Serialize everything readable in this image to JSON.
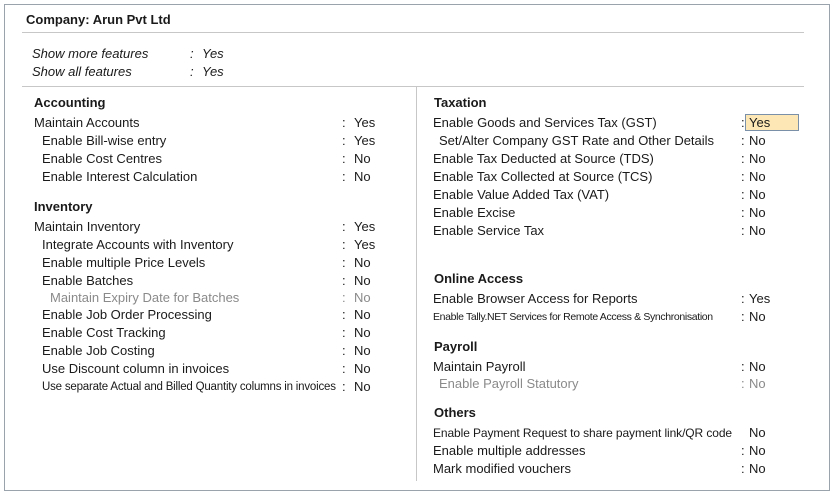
{
  "company": "Company: Arun Pvt Ltd",
  "features": [
    {
      "label": "Show more features",
      "value": "Yes"
    },
    {
      "label": "Show all features",
      "value": "Yes"
    }
  ],
  "accounting": {
    "title": "Accounting",
    "items": [
      {
        "label": "Maintain Accounts",
        "value": "Yes"
      },
      {
        "label": "Enable Bill-wise entry",
        "value": "Yes"
      },
      {
        "label": "Enable Cost Centres",
        "value": "No"
      },
      {
        "label": "Enable Interest Calculation",
        "value": "No"
      }
    ]
  },
  "inventory": {
    "title": "Inventory",
    "items": [
      {
        "label": "Maintain Inventory",
        "value": "Yes"
      },
      {
        "label": "Integrate Accounts with Inventory",
        "value": "Yes"
      },
      {
        "label": "Enable multiple Price Levels",
        "value": "No"
      },
      {
        "label": "Enable Batches",
        "value": "No"
      },
      {
        "label": "Maintain Expiry Date for Batches",
        "value": "No"
      },
      {
        "label": "Enable Job Order Processing",
        "value": "No"
      },
      {
        "label": "Enable Cost Tracking",
        "value": "No"
      },
      {
        "label": "Enable Job Costing",
        "value": "No"
      },
      {
        "label": "Use Discount column in invoices",
        "value": "No"
      },
      {
        "label": "Use separate Actual and Billed Quantity columns in invoices",
        "value": "No"
      }
    ]
  },
  "taxation": {
    "title": "Taxation",
    "items": [
      {
        "label": "Enable Goods and Services Tax (GST)",
        "value": "Yes"
      },
      {
        "label": "Set/Alter Company GST Rate and Other Details",
        "value": "No"
      },
      {
        "label": "Enable Tax Deducted at Source (TDS)",
        "value": "No"
      },
      {
        "label": "Enable Tax Collected at Source (TCS)",
        "value": "No"
      },
      {
        "label": "Enable Value Added Tax (VAT)",
        "value": "No"
      },
      {
        "label": "Enable Excise",
        "value": "No"
      },
      {
        "label": "Enable Service Tax",
        "value": "No"
      }
    ]
  },
  "online": {
    "title": "Online Access",
    "items": [
      {
        "label": "Enable Browser Access for Reports",
        "value": "Yes"
      },
      {
        "label": "Enable Tally.NET Services for Remote Access & Synchronisation",
        "value": "No"
      }
    ]
  },
  "payroll": {
    "title": "Payroll",
    "items": [
      {
        "label": "Maintain Payroll",
        "value": "No"
      },
      {
        "label": "Enable Payroll Statutory",
        "value": "No"
      }
    ]
  },
  "others": {
    "title": "Others",
    "items": [
      {
        "label": "Enable Payment Request to share payment link/QR code",
        "value": "No"
      },
      {
        "label": "Enable multiple addresses",
        "value": "No"
      },
      {
        "label": "Mark modified vouchers",
        "value": "No"
      }
    ]
  }
}
